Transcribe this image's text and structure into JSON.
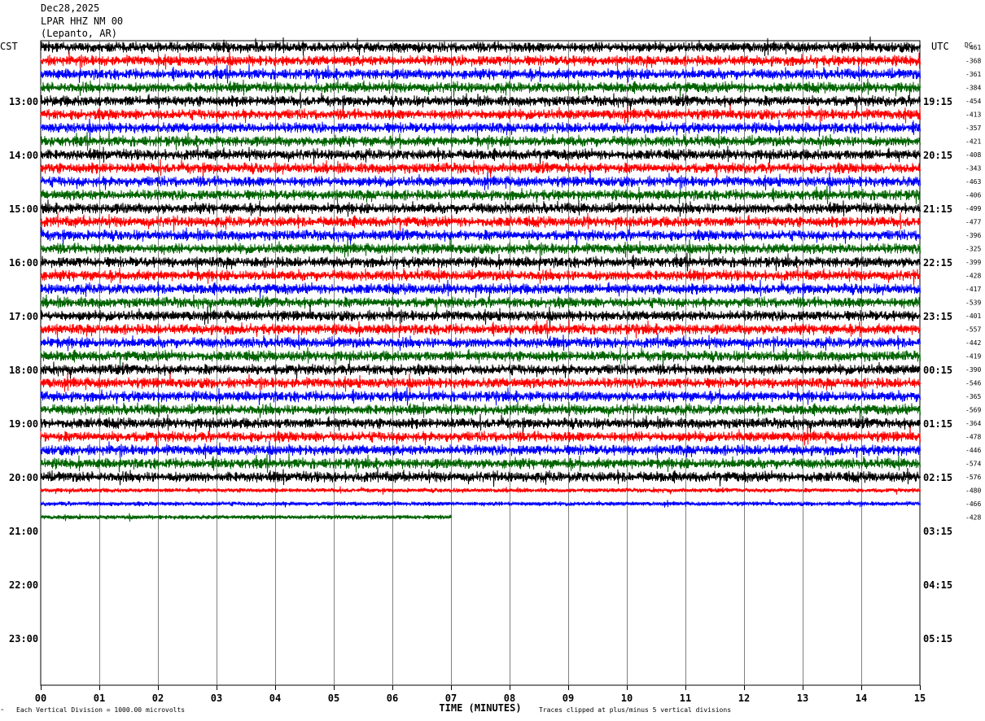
{
  "header": {
    "date": "Dec28,2025",
    "station": "LPAR HHZ NM 00",
    "location": "(Lepanto, AR)"
  },
  "chart_data": {
    "type": "line",
    "title": "LPAR HHZ NM 00",
    "left_axis_label": "CST",
    "right_axis_label": "UTC",
    "dc_label": "DC",
    "xlabel": "TIME (MINUTES)",
    "xlim": [
      0,
      15
    ],
    "x_ticks": [
      "00",
      "01",
      "02",
      "03",
      "04",
      "05",
      "06",
      "07",
      "08",
      "09",
      "10",
      "11",
      "12",
      "13",
      "14",
      "15"
    ],
    "cst_hour_labels": [
      "13:00",
      "14:00",
      "15:00",
      "16:00",
      "17:00",
      "18:00",
      "19:00",
      "20:00",
      "21:00",
      "22:00",
      "23:00"
    ],
    "utc_hour_labels": [
      "19:15",
      "20:15",
      "21:15",
      "22:15",
      "23:15",
      "00:15",
      "01:15",
      "02:15",
      "03:15",
      "04:15",
      "05:15"
    ],
    "trace_colors": [
      "#000000",
      "#ff0000",
      "#0000ff",
      "#006400"
    ],
    "rows_per_hour": 4,
    "total_rows": 48,
    "dc_offsets": [
      "-461",
      "-368",
      "-361",
      "-384",
      "-454",
      "-413",
      "-357",
      "-421",
      "-408",
      "-343",
      "-463",
      "-406",
      "-499",
      "-477",
      "-396",
      "-325",
      "-399",
      "-428",
      "-417",
      "-539",
      "-401",
      "-557",
      "-442",
      "-419",
      "-390",
      "-546",
      "-365",
      "-569",
      "-364",
      "-478",
      "-446",
      "-574",
      "-576",
      "-480",
      "-466",
      "-428"
    ],
    "last_trace_end_minutes": 7.0,
    "grid": "vertical-minutes",
    "footer_left": "Each Vertical Division = 1000.00 microvolts",
    "footer_right": "Traces clipped at plus/minus 5 vertical divisions"
  }
}
